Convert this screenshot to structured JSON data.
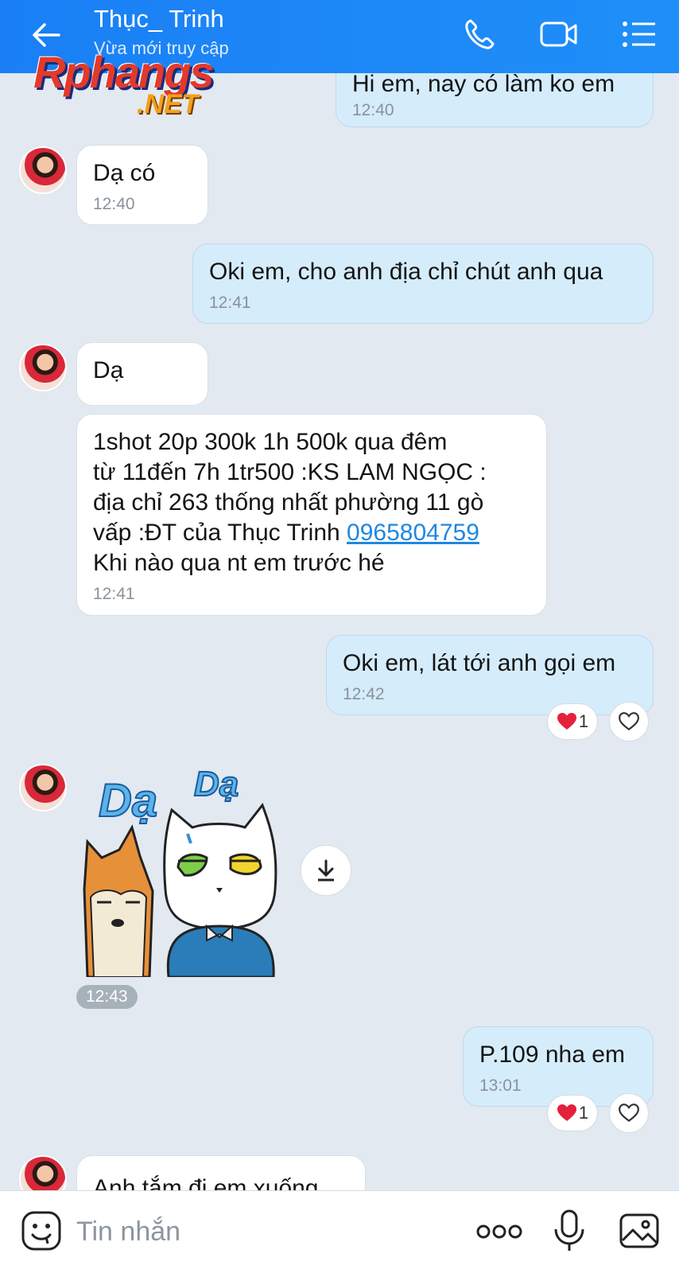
{
  "header": {
    "title": "Thục_ Trinh",
    "subtitle": "Vừa mới truy cập"
  },
  "watermark": {
    "main": "Rphangs",
    "net": ".NET"
  },
  "messages": [
    {
      "dir": "out",
      "text": "Hi em, nay có làm ko em",
      "time": "12:40"
    },
    {
      "dir": "in",
      "text": "Dạ có",
      "time": "12:40"
    },
    {
      "dir": "out",
      "text": "Oki em, cho anh địa chỉ chút anh qua",
      "time": "12:41"
    },
    {
      "dir": "in",
      "text": "Dạ",
      "time": ""
    },
    {
      "dir": "in",
      "text_before": "1shot 20p 300k 1h 500k qua đêm\ntừ 11đến 7h 1tr500 :KS LAM NGỌC :\nđịa chỉ 263 thống nhất phường 11 gò\nvấp :ĐT  của Thục Trinh ",
      "phone": "0965804759",
      "text_after": "\nKhi nào qua nt em trước hé",
      "time": "12:41"
    },
    {
      "dir": "out",
      "text": "Oki em, lát tới anh gọi em",
      "time": "12:42",
      "reaction_count": "1"
    },
    {
      "dir": "in",
      "sticker": "da-da-cats-sticker",
      "sticker_text": [
        "Dạ",
        "Dạ"
      ],
      "time": "12:43"
    },
    {
      "dir": "out",
      "text": "P.109 nha em",
      "time": "13:01",
      "reaction_count": "1"
    },
    {
      "dir": "in",
      "text": "Anh tắm đi em xuống",
      "time": ""
    }
  ],
  "composer": {
    "placeholder": "Tin nhắn"
  },
  "colors": {
    "header": "#1a7ff5",
    "outgoing_bubble": "#d5ecfb",
    "incoming_bubble": "#ffffff",
    "background": "#e2e9f1",
    "link": "#1f87e0",
    "heart": "#e5203a"
  }
}
